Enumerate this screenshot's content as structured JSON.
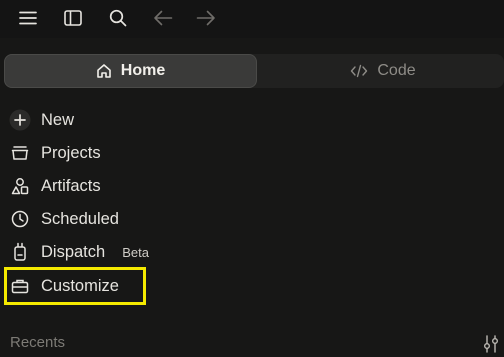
{
  "toolbar": {
    "icons": [
      "menu-icon",
      "sidebar-icon",
      "search-icon",
      "back-arrow-icon",
      "forward-arrow-icon"
    ]
  },
  "mode_switch": {
    "home_label": "Home",
    "code_label": "Code",
    "active": "home"
  },
  "nav": {
    "items": [
      {
        "label": "New",
        "icon": "plus-icon"
      },
      {
        "label": "Projects",
        "icon": "projects-icon"
      },
      {
        "label": "Artifacts",
        "icon": "artifacts-icon"
      },
      {
        "label": "Scheduled",
        "icon": "clock-icon"
      },
      {
        "label": "Dispatch",
        "icon": "dispatch-icon",
        "badge": "Beta"
      },
      {
        "label": "Customize",
        "icon": "briefcase-icon",
        "highlighted": true
      }
    ]
  },
  "recents": {
    "label": "Recents"
  },
  "colors": {
    "background": "#171716",
    "highlight": "#f5ea00",
    "active_tab": "#3a3a39"
  }
}
